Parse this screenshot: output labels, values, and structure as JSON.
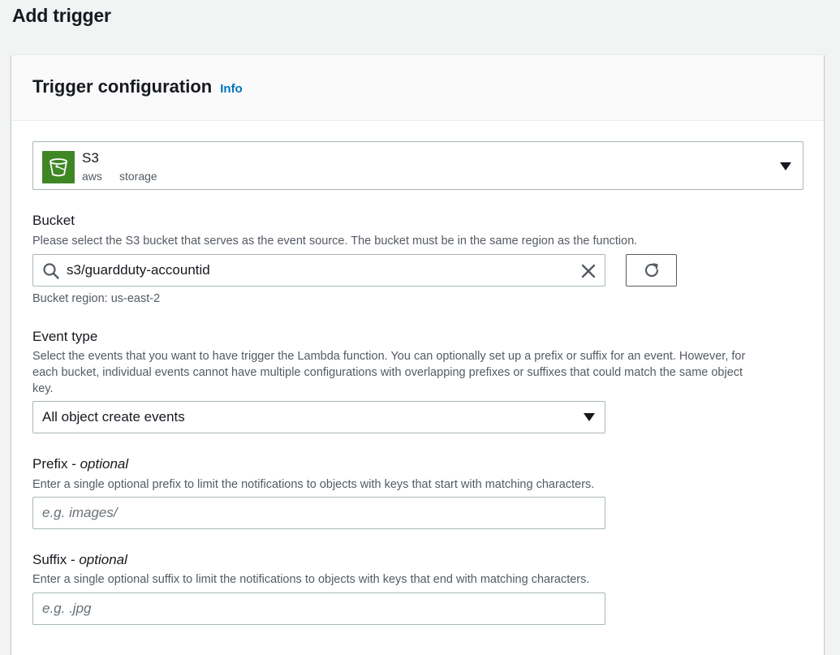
{
  "page": {
    "title": "Add trigger"
  },
  "panel": {
    "title": "Trigger configuration",
    "info_label": "Info"
  },
  "source": {
    "name": "S3",
    "tags": [
      "aws",
      "storage"
    ],
    "icon": "s3-bucket-icon",
    "icon_color": "#3f8624"
  },
  "bucket": {
    "label": "Bucket",
    "description": "Please select the S3 bucket that serves as the event source. The bucket must be in the same region as the function.",
    "value": "s3/guardduty-accountid",
    "region_text": "Bucket region: us-east-2"
  },
  "event_type": {
    "label": "Event type",
    "description_line1": "Select the events that you want to have trigger the Lambda function. You can optionally set up a prefix or suffix for an event. However, for",
    "description_line2": "each bucket, individual events cannot have multiple configurations with overlapping prefixes or suffixes that could match the same object",
    "description_line3": "key.",
    "selected": "All object create events"
  },
  "prefix": {
    "label": "Prefix",
    "optional_label": "optional",
    "description": "Enter a single optional prefix to limit the notifications to objects with keys that start with matching characters.",
    "placeholder": "e.g. images/"
  },
  "suffix": {
    "label": "Suffix",
    "optional_label": "optional",
    "description": "Enter a single optional suffix to limit the notifications to objects with keys that end with matching characters.",
    "placeholder": "e.g. .jpg"
  },
  "colors": {
    "link": "#0073bb",
    "border": "#aab7b8",
    "muted_text": "#545b64"
  }
}
